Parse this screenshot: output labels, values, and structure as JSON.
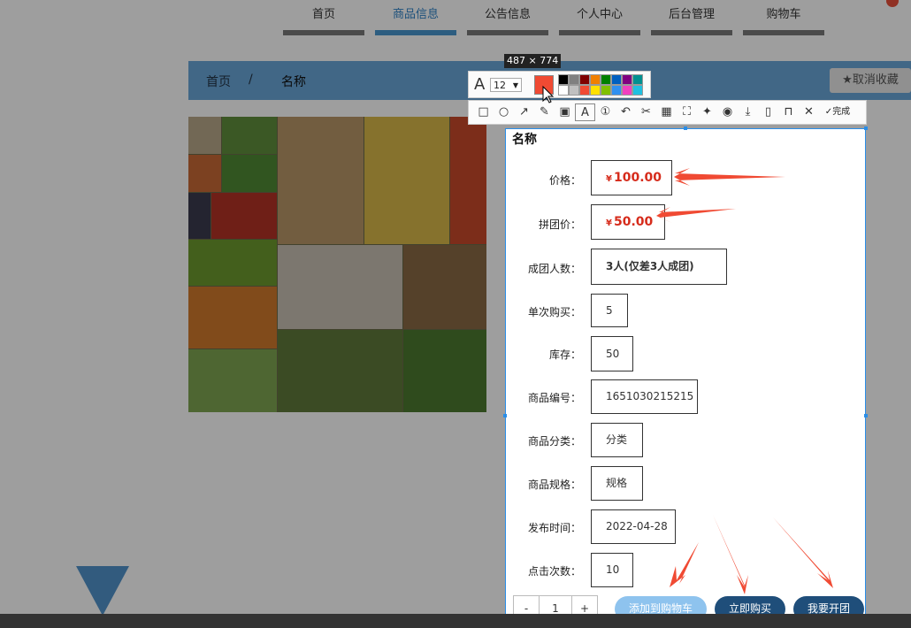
{
  "nav": {
    "items": [
      {
        "label": "首页"
      },
      {
        "label": "商品信息"
      },
      {
        "label": "公告信息"
      },
      {
        "label": "个人中心"
      },
      {
        "label": "后台管理"
      },
      {
        "label": "购物车"
      }
    ],
    "active_index": 1
  },
  "breadcrumb": {
    "home": "首页",
    "separator": "/",
    "current": "名称"
  },
  "cancel_favorite_label": "取消收藏",
  "gallery": {
    "tiles": [
      "garlic",
      "green beans",
      "cucumber",
      "potatoes",
      "corn",
      "tomatoes",
      "peppers",
      "green beans",
      "garlic",
      "carrots",
      "pumpkin",
      "bok choy",
      "peas",
      "cabbage",
      "eggplant",
      "beans"
    ]
  },
  "capture": {
    "size_label": "487 × 774",
    "font_size": "12",
    "current_color": "#f04a33",
    "palette": [
      "#000000",
      "#808080",
      "#800000",
      "#f08000",
      "#008000",
      "#0060c0",
      "#800080",
      "#009090",
      "#ffffff",
      "#c0c0c0",
      "#f04a33",
      "#ffe000",
      "#80c000",
      "#3090f0",
      "#f040c0",
      "#20c0e0"
    ],
    "tools": [
      "rectangle-icon",
      "ellipse-icon",
      "arrow-icon",
      "pencil-icon",
      "mosaic-icon",
      "text-icon",
      "number-icon",
      "undo-icon",
      "pin-icon",
      "ocr-icon",
      "scan-icon",
      "pin2-icon",
      "record-icon",
      "download-icon",
      "phone-icon",
      "bookmark-icon",
      "close-icon"
    ],
    "done_label": "完成"
  },
  "product": {
    "title": "名称",
    "rows": [
      {
        "label": "价格：",
        "value": "100.00",
        "currency": "¥",
        "kind": "price"
      },
      {
        "label": "拼团价：",
        "value": "50.00",
        "currency": "¥",
        "kind": "price"
      },
      {
        "label": "成团人数：",
        "value": "3人(仅差3人成团)",
        "kind": "big"
      },
      {
        "label": "单次购买：",
        "value": "5",
        "kind": "plain"
      },
      {
        "label": "库存：",
        "value": "50",
        "kind": "plain"
      },
      {
        "label": "商品编号：",
        "value": "1651030215215",
        "kind": "plain"
      },
      {
        "label": "商品分类：",
        "value": "分类",
        "kind": "plain"
      },
      {
        "label": "商品规格：",
        "value": "规格",
        "kind": "plain"
      },
      {
        "label": "发布时间：",
        "value": "2022-04-28",
        "kind": "plain"
      },
      {
        "label": "点击次数：",
        "value": "10",
        "kind": "plain"
      }
    ],
    "quantity": {
      "minus": "-",
      "value": "1",
      "plus": "+"
    },
    "add_to_cart_label": "添加到购物车",
    "buy_now_label": "立即购买",
    "start_group_label": "我要开团"
  },
  "colors": {
    "accent": "#2f83c9",
    "annotation": "#f04a33",
    "button_dark": "#1f4e7a",
    "button_light": "#8ec3ee"
  }
}
